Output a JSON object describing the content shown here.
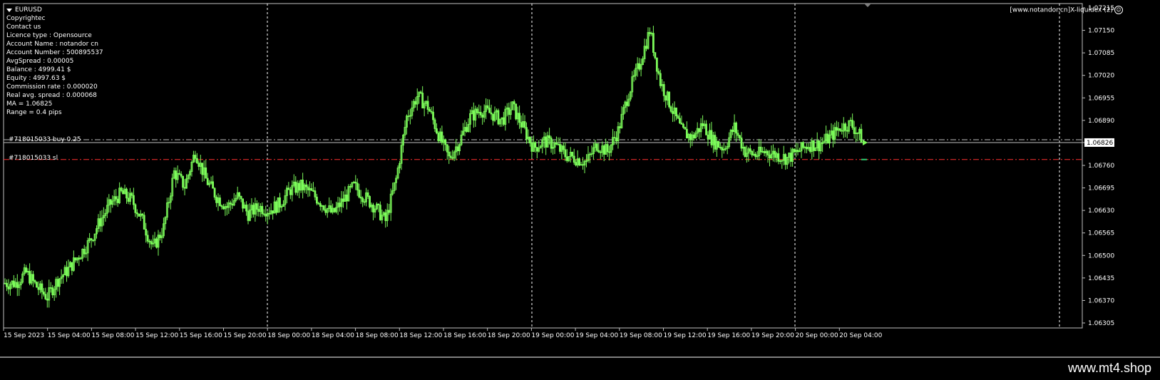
{
  "chart_data": {
    "type": "candlestick",
    "symbol": "EURUSD",
    "ylim": [
      1.06305,
      1.07215
    ],
    "y_ticks": [
      "1.07215",
      "1.07150",
      "1.07085",
      "1.07020",
      "1.06955",
      "1.06890",
      "1.06826",
      "1.06760",
      "1.06695",
      "1.06630",
      "1.06565",
      "1.06500",
      "1.06435",
      "1.06370",
      "1.06305"
    ],
    "x_ticks": [
      "15 Sep 2023",
      "15 Sep 04:00",
      "15 Sep 08:00",
      "15 Sep 12:00",
      "15 Sep 16:00",
      "15 Sep 20:00",
      "18 Sep 00:00",
      "18 Sep 04:00",
      "18 Sep 08:00",
      "18 Sep 12:00",
      "18 Sep 16:00",
      "18 Sep 20:00",
      "19 Sep 00:00",
      "19 Sep 04:00",
      "19 Sep 08:00",
      "19 Sep 12:00",
      "19 Sep 16:00",
      "19 Sep 20:00",
      "20 Sep 00:00",
      "20 Sep 04:00"
    ],
    "close_path": [
      [
        0,
        1.0642
      ],
      [
        6,
        1.0642
      ],
      [
        12,
        1.0645
      ],
      [
        18,
        1.0641
      ],
      [
        24,
        1.0638
      ],
      [
        30,
        1.0643
      ],
      [
        36,
        1.0646
      ],
      [
        42,
        1.065
      ],
      [
        48,
        1.0654
      ],
      [
        54,
        1.066
      ],
      [
        60,
        1.0665
      ],
      [
        66,
        1.0668
      ],
      [
        72,
        1.0666
      ],
      [
        78,
        1.066
      ],
      [
        84,
        1.0652
      ],
      [
        90,
        1.0658
      ],
      [
        96,
        1.0674
      ],
      [
        102,
        1.067
      ],
      [
        108,
        1.068
      ],
      [
        114,
        1.0672
      ],
      [
        120,
        1.0667
      ],
      [
        126,
        1.0664
      ],
      [
        132,
        1.0667
      ],
      [
        138,
        1.0662
      ],
      [
        144,
        1.0664
      ],
      [
        150,
        1.0663
      ],
      [
        156,
        1.0665
      ],
      [
        162,
        1.0669
      ],
      [
        168,
        1.067
      ],
      [
        174,
        1.0668
      ],
      [
        180,
        1.0665
      ],
      [
        186,
        1.0662
      ],
      [
        192,
        1.0666
      ],
      [
        198,
        1.067
      ],
      [
        204,
        1.0667
      ],
      [
        210,
        1.0664
      ],
      [
        216,
        1.066
      ],
      [
        222,
        1.0672
      ],
      [
        228,
        1.069
      ],
      [
        234,
        1.0696
      ],
      [
        240,
        1.0693
      ],
      [
        246,
        1.0685
      ],
      [
        252,
        1.0678
      ],
      [
        258,
        1.0683
      ],
      [
        264,
        1.069
      ],
      [
        270,
        1.0692
      ],
      [
        276,
        1.0691
      ],
      [
        282,
        1.0689
      ],
      [
        288,
        1.0693
      ],
      [
        294,
        1.0687
      ],
      [
        300,
        1.0681
      ],
      [
        306,
        1.0683
      ],
      [
        312,
        1.0682
      ],
      [
        318,
        1.0679
      ],
      [
        324,
        1.0678
      ],
      [
        330,
        1.0677
      ],
      [
        336,
        1.0682
      ],
      [
        342,
        1.068
      ],
      [
        348,
        1.0686
      ],
      [
        354,
        1.0697
      ],
      [
        360,
        1.0705
      ],
      [
        366,
        1.0715
      ],
      [
        372,
        1.07
      ],
      [
        378,
        1.0693
      ],
      [
        384,
        1.0686
      ],
      [
        390,
        1.0684
      ],
      [
        396,
        1.0688
      ],
      [
        402,
        1.0683
      ],
      [
        408,
        1.0681
      ],
      [
        414,
        1.0687
      ],
      [
        420,
        1.068
      ],
      [
        426,
        1.0679
      ],
      [
        432,
        1.068
      ],
      [
        438,
        1.0679
      ],
      [
        444,
        1.0678
      ],
      [
        450,
        1.068
      ],
      [
        456,
        1.0682
      ],
      [
        462,
        1.0682
      ],
      [
        468,
        1.0684
      ],
      [
        474,
        1.0687
      ],
      [
        480,
        1.0688
      ],
      [
        486,
        1.0684
      ]
    ],
    "min_lines": [
      {
        "label": "#718015033 buy 0.25",
        "value": 1.06834,
        "color": "#bfbfbf",
        "style": "dashdot"
      },
      {
        "label": "",
        "value": 1.06826,
        "color": "#bfbfbf",
        "style": "solid"
      },
      {
        "label": "#718015033 sl",
        "value": 1.06777,
        "color": "#ff3030",
        "style": "dashdot"
      }
    ],
    "series_color": "#7cfc5a"
  },
  "info": {
    "symbol": "EURUSD",
    "lines": [
      "Copyrightec",
      "Contact us",
      "Licence type : Opensource",
      "Account Name : notandor cn",
      "Account Number : 500895537",
      "AvgSpread : 0.00005",
      "Balance : 4999.41 $",
      "Equity : 4997.63 $",
      "Commission rate : 0.000020",
      "Real avg. spread : 0.000068",
      "MA = 1.06825",
      "Range = 0.4 pips"
    ]
  },
  "brand": "[www.notandor.cn]X-liquidex (2)",
  "brand_icon": "smiley-icon",
  "current_price": "1.06826",
  "orders": {
    "buy_label": "#718015033 buy 0.25",
    "sl_label": "#718015033 sl"
  },
  "footer": {
    "site": "www.mt4.shop"
  }
}
